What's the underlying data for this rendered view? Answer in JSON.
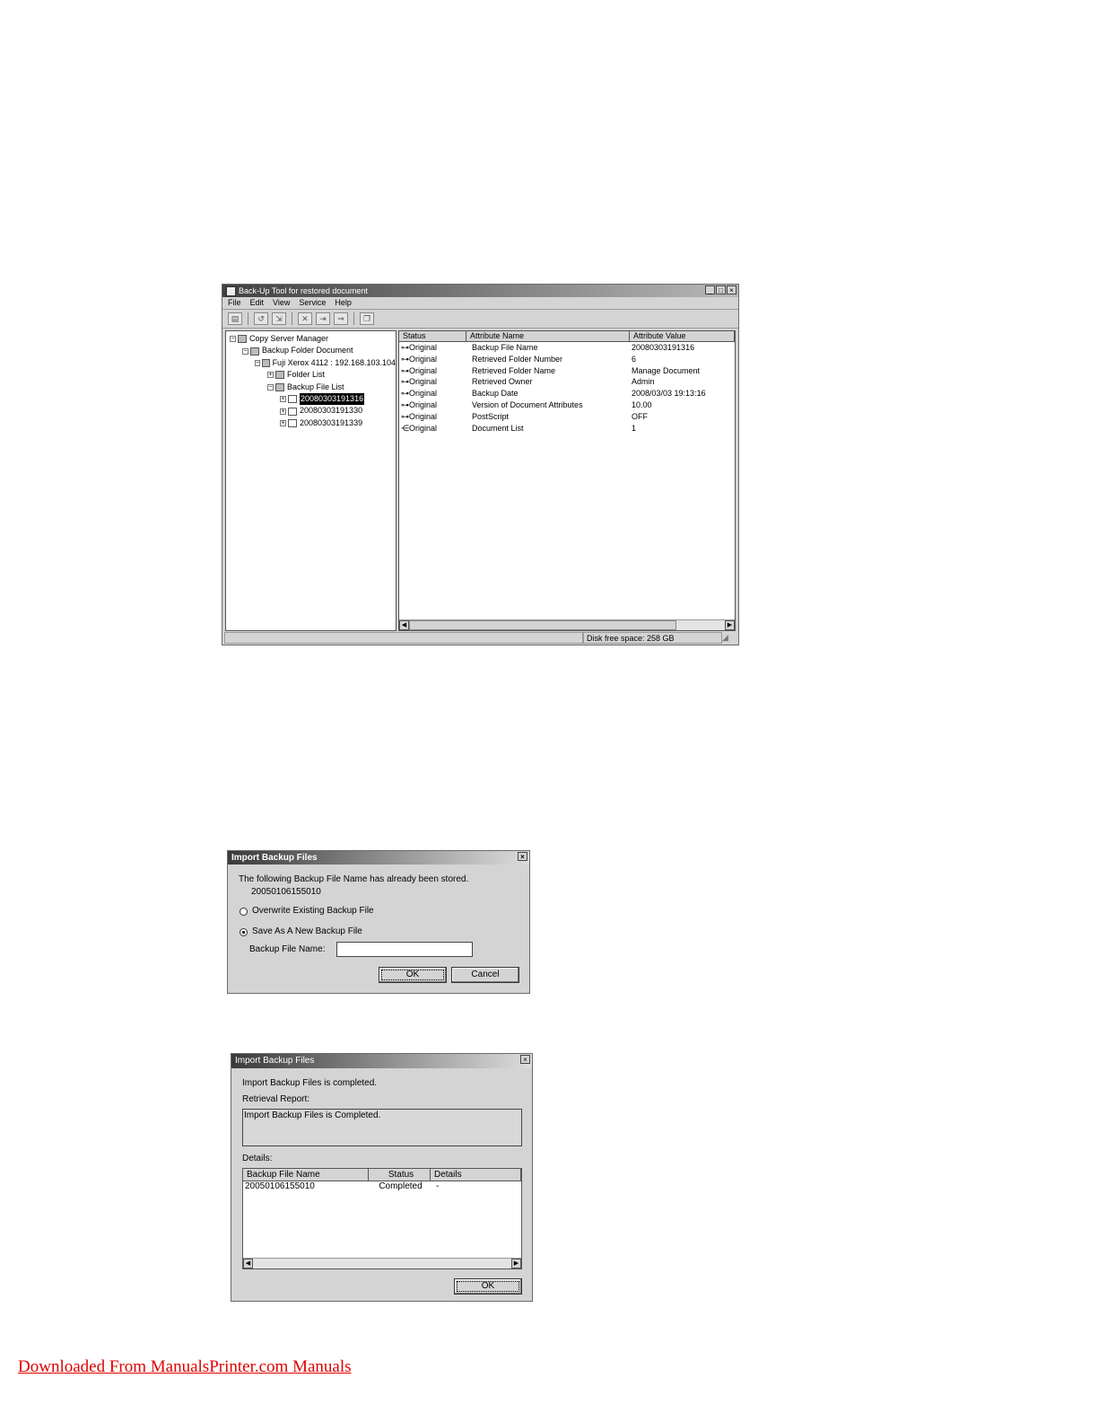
{
  "main_window": {
    "title": "Back-Up Tool for restored document",
    "menu": [
      "File",
      "Edit",
      "View",
      "Service",
      "Help"
    ],
    "tree": [
      {
        "label": "Copy Server Manager",
        "level": 0,
        "expander": "−"
      },
      {
        "label": "Backup Folder  Document",
        "level": 1,
        "expander": "−"
      },
      {
        "label": "Fuji Xerox 4112 : 192.168.103.104",
        "level": 2,
        "expander": "−"
      },
      {
        "label": "Folder List",
        "level": 3,
        "expander": "+"
      },
      {
        "label": "Backup File List",
        "level": 3,
        "expander": "−"
      },
      {
        "label": "20080303191316",
        "level": 4,
        "expander": "+",
        "selected": true
      },
      {
        "label": "20080303191330",
        "level": 4,
        "expander": "+"
      },
      {
        "label": "20080303191339",
        "level": 4,
        "expander": "+"
      }
    ],
    "list_columns": [
      "Status",
      "Attribute Name",
      "Attribute Value"
    ],
    "list_rows": [
      {
        "status": "Original",
        "name": "Backup File Name",
        "value": "20080303191316"
      },
      {
        "status": "Original",
        "name": "Retrieved Folder Number",
        "value": "6"
      },
      {
        "status": "Original",
        "name": "Retrieved Folder Name",
        "value": "Manage Document"
      },
      {
        "status": "Original",
        "name": "Retrieved Owner",
        "value": "Admin"
      },
      {
        "status": "Original",
        "name": "Backup Date",
        "value": "2008/03/03 19:13:16"
      },
      {
        "status": "Original",
        "name": "Version of Document Attributes",
        "value": "10.00"
      },
      {
        "status": "Original",
        "name": "PostScript",
        "value": "OFF"
      },
      {
        "status": "Original",
        "name": "Document List",
        "value": "1"
      }
    ],
    "status_text": "Disk free space: 258 GB"
  },
  "dialog1": {
    "title": "Import Backup Files",
    "message": "The following Backup File Name has already been stored.",
    "filename": "20050106155010",
    "option_overwrite": "Overwrite Existing Backup File",
    "option_save_new": "Save As A New Backup File",
    "field_label": "Backup File Name:",
    "field_value": "",
    "ok_label": "OK",
    "cancel_label": "Cancel"
  },
  "dialog2": {
    "title": "Import Backup Files",
    "message": "Import Backup Files is completed.",
    "report_label": "Retrieval Report:",
    "report_text": "Import Backup Files is Completed.",
    "details_label": "Details:",
    "columns": [
      "Backup File Name",
      "Status",
      "Details"
    ],
    "rows": [
      {
        "file": "20050106155010",
        "status": "Completed",
        "details": "-"
      }
    ],
    "ok_label": "OK"
  },
  "footer": {
    "link_text": "Downloaded From ManualsPrinter.com Manuals",
    "color": "#e00000"
  }
}
